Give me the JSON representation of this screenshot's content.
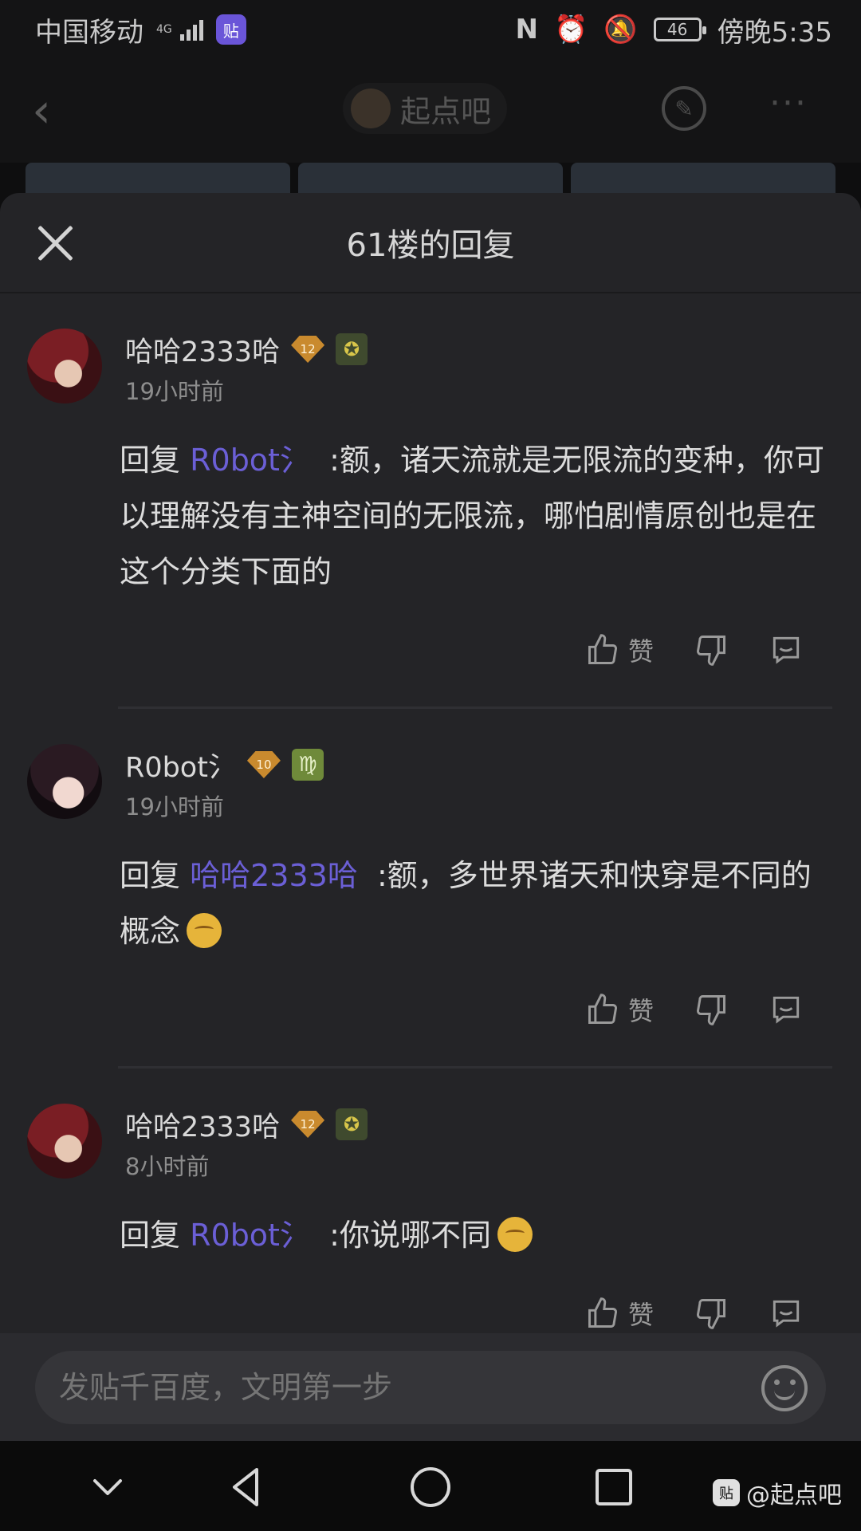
{
  "status_bar": {
    "carrier": "中国移动",
    "network_badge": "4G",
    "app_badge": "贴",
    "battery": "46",
    "time": "傍晚5:35",
    "icons": [
      "nfc-icon",
      "alarm-icon",
      "mute-icon",
      "battery-icon"
    ]
  },
  "header": {
    "forum_name": "起点吧",
    "icons": [
      "back-icon",
      "edit-icon",
      "more-icon"
    ]
  },
  "sheet": {
    "title": "61楼的回复"
  },
  "replies": [
    {
      "username": "哈哈2333哈",
      "level": "12",
      "time": "19小时前",
      "prefix": "回复",
      "mention": "R0bot氵",
      "text": ":额，诸天流就是无限流的变种，你可以理解没有主神空间的无限流，哪怕剧情原创也是在这个分类下面的",
      "like_label": "赞"
    },
    {
      "username": "R0bot氵",
      "level": "10",
      "time": "19小时前",
      "prefix": "回复",
      "mention": "哈哈2333哈",
      "text": ":额，多世界诸天和快穿是不同的概念",
      "like_label": "赞"
    },
    {
      "username": "哈哈2333哈",
      "level": "12",
      "time": "8小时前",
      "prefix": "回复",
      "mention": "R0bot氵",
      "text": ":你说哪不同",
      "like_label": "赞"
    }
  ],
  "composer": {
    "placeholder": "发贴千百度，文明第一步"
  },
  "watermark": {
    "badge": "贴",
    "text": "@起点吧"
  },
  "colors": {
    "background": "#0e0e0f",
    "sheet": "#242427",
    "mention": "#6b5fd6",
    "level_badge": "#c98a2e"
  }
}
